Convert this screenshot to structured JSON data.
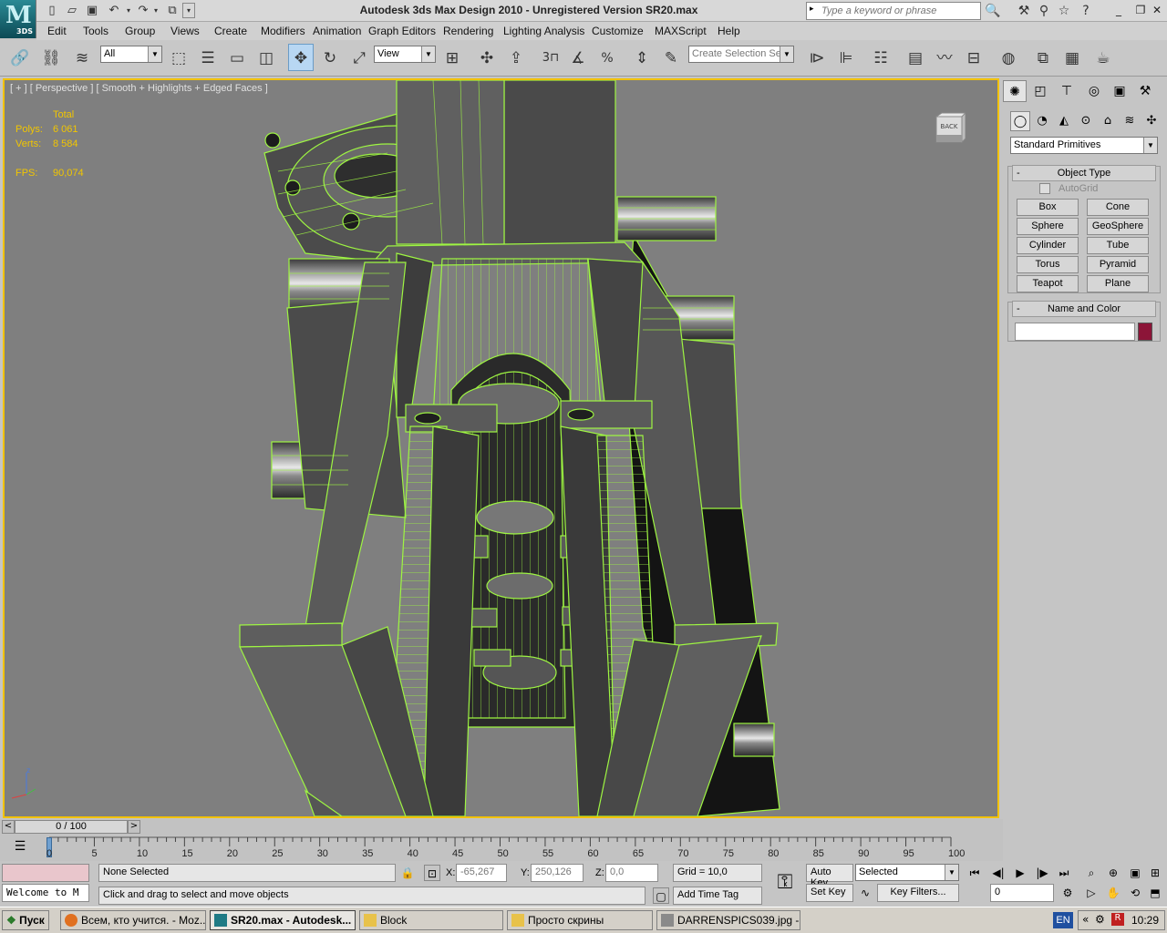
{
  "app": {
    "logo_text": "3DS",
    "title": "Autodesk 3ds Max Design 2010  - Unregistered Version     SR20.max",
    "search_placeholder": "Type a keyword or phrase"
  },
  "menu": [
    "Edit",
    "Tools",
    "Group",
    "Views",
    "Create",
    "Modifiers",
    "Animation",
    "Graph Editors",
    "Rendering",
    "Lighting Analysis",
    "Customize",
    "MAXScript",
    "Help"
  ],
  "toolbar": {
    "selection_filter": "All",
    "ref_coord": "View",
    "named_selection": "Create Selection Se",
    "snap_label": "3"
  },
  "viewport": {
    "label": "[ + ] [ Perspective ] [ Smooth + Highlights + Edged Faces ]",
    "stats_header": "Total",
    "polys_label": "Polys:",
    "polys_value": "6 061",
    "verts_label": "Verts:",
    "verts_value": "8 584",
    "fps_label": "FPS:",
    "fps_value": "90,074",
    "viewcube_label": "BACK",
    "axis_z": "z",
    "wire_color": "#9ef542",
    "frame_color": "#f2c200"
  },
  "command_panel": {
    "category": "Standard Primitives",
    "object_type_title": "Object Type",
    "autogrid_label": "AutoGrid",
    "primitives": [
      "Box",
      "Cone",
      "Sphere",
      "GeoSphere",
      "Cylinder",
      "Tube",
      "Torus",
      "Pyramid",
      "Teapot",
      "Plane"
    ],
    "name_color_title": "Name and Color",
    "object_name": "",
    "object_color": "#8c1538"
  },
  "timeline": {
    "frame_display": "0 / 100",
    "ticks": [
      "0",
      "5",
      "10",
      "15",
      "20",
      "25",
      "30",
      "35",
      "40",
      "45",
      "50",
      "55",
      "60",
      "65",
      "70",
      "75",
      "80",
      "85",
      "90",
      "95",
      "100"
    ]
  },
  "status": {
    "maxscript_listener": "Welcome to M",
    "selection_info": "None Selected",
    "prompt": "Click and drag to select and move objects",
    "x_label": "X:",
    "x_value": "-65,267",
    "y_label": "Y:",
    "y_value": "250,126",
    "z_label": "Z:",
    "z_value": "0,0",
    "grid": "Grid = 10,0",
    "add_time_tag": "Add Time Tag",
    "auto_key": "Auto Key",
    "set_key": "Set Key",
    "key_mode": "Selected",
    "key_filters": "Key Filters...",
    "current_frame": "0"
  },
  "taskbar": {
    "start": "Пуск",
    "tasks": [
      "Всем, кто учится. - Moz...",
      "SR20.max - Autodesk...",
      "Block",
      "Просто скрины",
      "DARRENSPICS039.jpg - ..."
    ],
    "lang": "EN",
    "clock": "10:29"
  }
}
